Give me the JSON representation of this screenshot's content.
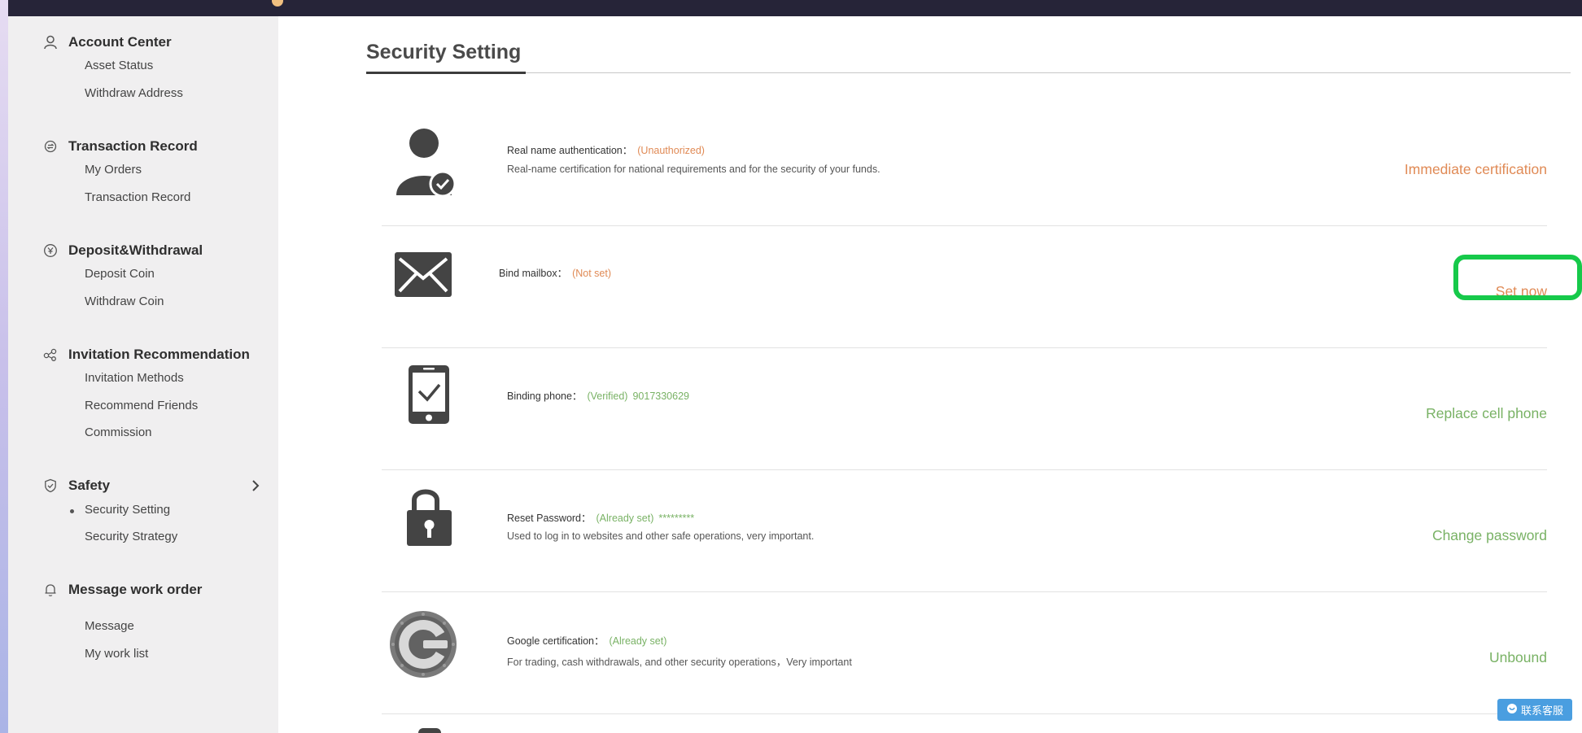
{
  "sidebar": {
    "sections": [
      {
        "title": "Account Center",
        "icon": "user-icon",
        "items": [
          "Asset Status",
          "Withdraw Address"
        ]
      },
      {
        "title": "Transaction Record",
        "icon": "exchange-icon",
        "items": [
          "My Orders",
          "Transaction Record"
        ]
      },
      {
        "title": "Deposit&Withdrawal",
        "icon": "coin-icon",
        "items": [
          "Deposit Coin",
          "Withdraw Coin"
        ]
      },
      {
        "title": "Invitation Recommendation",
        "icon": "share-icon",
        "items": [
          "Invitation Methods",
          "Recommend Friends",
          "Commission"
        ]
      },
      {
        "title": "Safety",
        "icon": "shield-icon",
        "items": [
          "Security Setting",
          "Security Strategy"
        ],
        "expanded": true,
        "active_item": "Security Setting"
      },
      {
        "title": "Message work order",
        "icon": "bell-icon",
        "items": [
          "Message",
          "My work list"
        ]
      }
    ]
  },
  "main": {
    "title": "Security Setting",
    "rows": [
      {
        "label": "Real name authentication：",
        "status": "(Unauthorized)",
        "status_color": "#e08a55",
        "extra": "",
        "description": "Real-name certification for national requirements and for the security of your funds.",
        "action": "Immediate certification",
        "action_color": "#e08a55",
        "icon": "user-verified-icon"
      },
      {
        "label": "Bind mailbox：",
        "status": "(Not set)",
        "status_color": "#e08a55",
        "extra": "",
        "description": "",
        "action": "Set now",
        "action_color": "#e08a55",
        "icon": "mail-icon"
      },
      {
        "label": "Binding phone：",
        "status": "(Verified)",
        "status_color": "#79b265",
        "extra": "9017330629",
        "description": "",
        "action": "Replace cell phone",
        "action_color": "#79b265",
        "icon": "phone-check-icon"
      },
      {
        "label": "Reset Password：",
        "status": "(Already set)",
        "status_color": "#79b265",
        "extra": "*********",
        "description": "Used to log in to websites and other safe operations, very important.",
        "action": "Change password",
        "action_color": "#79b265",
        "icon": "lock-icon"
      },
      {
        "label": "Google certification：",
        "status": "(Already set)",
        "status_color": "#79b265",
        "extra": "",
        "description": "For trading, cash withdrawals, and other security operations，Very important",
        "action": "Unbound",
        "action_color": "#79b265",
        "icon": "google-authenticator-icon"
      }
    ]
  },
  "customer_service": {
    "label": "联系客服",
    "icon": "chat-icon"
  }
}
